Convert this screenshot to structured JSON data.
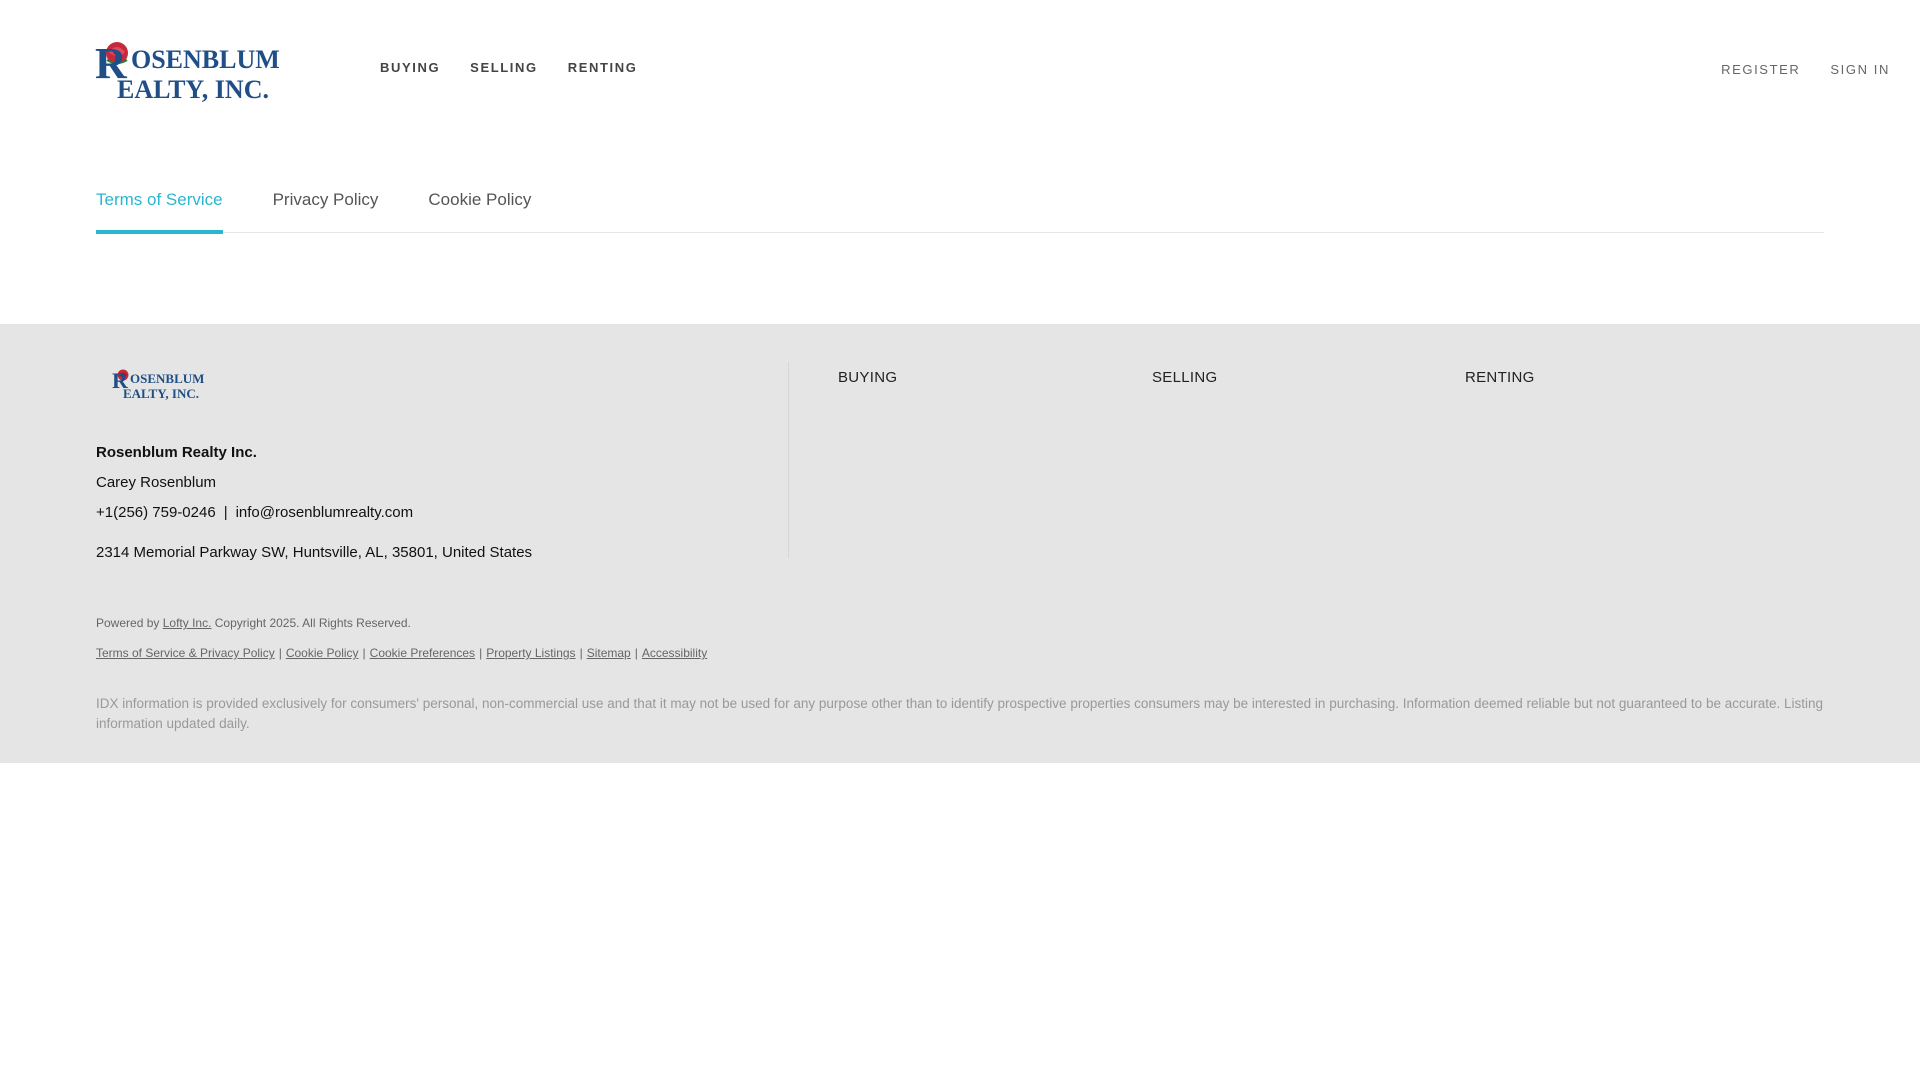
{
  "header": {
    "logo_alt": "Rosenblum Realty, Inc.",
    "logo_line1": "OSENBLUM",
    "logo_line2": "EALTY, INC.",
    "logo_initial": "R",
    "nav": [
      {
        "label": "BUYING"
      },
      {
        "label": "SELLING"
      },
      {
        "label": "RENTING"
      }
    ],
    "user_nav": {
      "register": "REGISTER",
      "sign_in": "SIGN IN"
    }
  },
  "tabs": [
    {
      "label": "Terms of Service",
      "active": true
    },
    {
      "label": "Privacy Policy",
      "active": false
    },
    {
      "label": "Cookie Policy",
      "active": false
    }
  ],
  "footer": {
    "company_name": "Rosenblum Realty Inc.",
    "contact_name": "Carey Rosenblum",
    "phone": "+1(256) 759-0246",
    "phone_sep": "|",
    "email": "info@rosenblumrealty.com",
    "address": "2314 Memorial Parkway SW, Huntsville, AL, 35801, United States",
    "nav": [
      {
        "label": "BUYING"
      },
      {
        "label": "SELLING"
      },
      {
        "label": "RENTING"
      }
    ],
    "powered_prefix": "Powered by",
    "powered_link": "Lofty Inc.",
    "powered_suffix": "Copyright 2025. All Rights Reserved.",
    "legal_links": [
      "Terms of Service & Privacy Policy",
      "Cookie Policy",
      "Cookie Preferences",
      "Property Listings",
      "Sitemap",
      "Accessibility"
    ],
    "disclaimer": "IDX information is provided exclusively for consumers' personal, non-commercial use and that it may not be used for any purpose other than to identify prospective properties consumers may be interested in purchasing. Information deemed reliable but not guaranteed to be accurate. Listing information updated daily."
  },
  "colors": {
    "accent": "#2bb6cf",
    "logo_blue": "#1f4f86",
    "logo_red": "#c8283c",
    "footer_bg": "#e5e5e5"
  }
}
